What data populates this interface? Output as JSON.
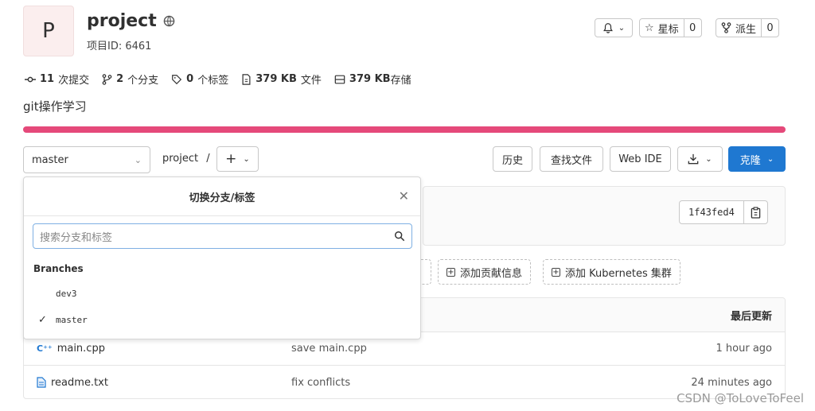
{
  "project": {
    "avatar_letter": "P",
    "name": "project",
    "id_label": "项目ID: 6461",
    "description": "git操作学习"
  },
  "header_actions": {
    "notification_icon": "bell-icon",
    "star_label": "星标",
    "star_count": "0",
    "fork_label": "派生",
    "fork_count": "0"
  },
  "stats": {
    "commits_count": "11",
    "commits_label": "次提交",
    "branches_count": "2",
    "branches_label": "个分支",
    "tags_count": "0",
    "tags_label": "个标签",
    "files_size": "379 KB",
    "files_label": "文件",
    "storage_size": "379 KB",
    "storage_label": "存储"
  },
  "colors": {
    "progress_bar": "#e5497a",
    "primary": "#1f78d1"
  },
  "toolbar": {
    "branch_selected": "master",
    "breadcrumb_project": "project",
    "breadcrumb_sep": "/",
    "history": "历史",
    "find_file": "查找文件",
    "web_ide": "Web IDE",
    "clone": "克隆"
  },
  "commit": {
    "sha": "1f43fed4"
  },
  "quick_actions": {
    "add_contribution": "添加贡献信息",
    "add_kubernetes": "添加 Kubernetes 集群"
  },
  "table": {
    "last_update_header": "最后更新",
    "rows": [
      {
        "name": "main.cpp",
        "message": "save main.cpp",
        "time": "1 hour ago"
      },
      {
        "name": "readme.txt",
        "message": "fix conflicts",
        "time": "24 minutes ago"
      }
    ]
  },
  "dropdown": {
    "title": "切换分支/标签",
    "search_placeholder": "搜索分支和标签",
    "branches_header": "Branches",
    "branches": [
      "dev3",
      "master"
    ],
    "selected": "master"
  },
  "watermark": "CSDN @ToLoveToFeel"
}
